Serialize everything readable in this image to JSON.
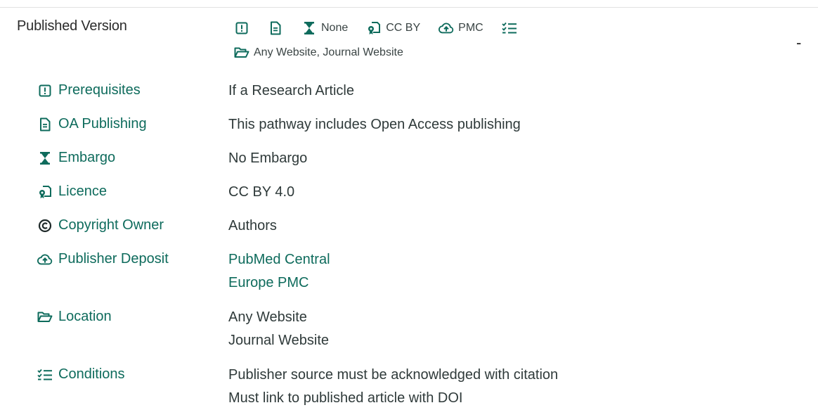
{
  "published_version": {
    "title": "Published Version",
    "summary": {
      "prerequisites_icon": "alert-square-icon",
      "oa_publishing_icon": "document-icon",
      "embargo": "None",
      "licence": "CC BY",
      "deposit": "PMC",
      "conditions_icon": "checklist-icon",
      "location": "Any Website, Journal Website"
    },
    "collapse_label": "-",
    "rows": [
      {
        "label": "Prerequisites",
        "icon": "alert-square-icon",
        "values": [
          "If a Research Article"
        ]
      },
      {
        "label": "OA Publishing",
        "icon": "document-icon",
        "values": [
          "This pathway includes Open Access publishing"
        ]
      },
      {
        "label": "Embargo",
        "icon": "hourglass-icon",
        "values": [
          "No Embargo"
        ]
      },
      {
        "label": "Licence",
        "icon": "licence-icon",
        "values": [
          "CC BY 4.0"
        ]
      },
      {
        "label": "Copyright Owner",
        "icon": "copyright-icon",
        "values": [
          "Authors"
        ]
      },
      {
        "label": "Publisher Deposit",
        "icon": "cloud-upload-icon",
        "values": [
          "PubMed Central",
          "Europe PMC"
        ]
      },
      {
        "label": "Location",
        "icon": "folder-open-icon",
        "values": [
          "Any Website",
          "Journal Website"
        ]
      },
      {
        "label": "Conditions",
        "icon": "checklist-icon",
        "values": [
          "Publisher source must be acknowledged with citation",
          "Must link to published article with DOI"
        ]
      }
    ]
  },
  "colors": {
    "accent": "#0e6b5c",
    "text": "#2f3a3a"
  }
}
